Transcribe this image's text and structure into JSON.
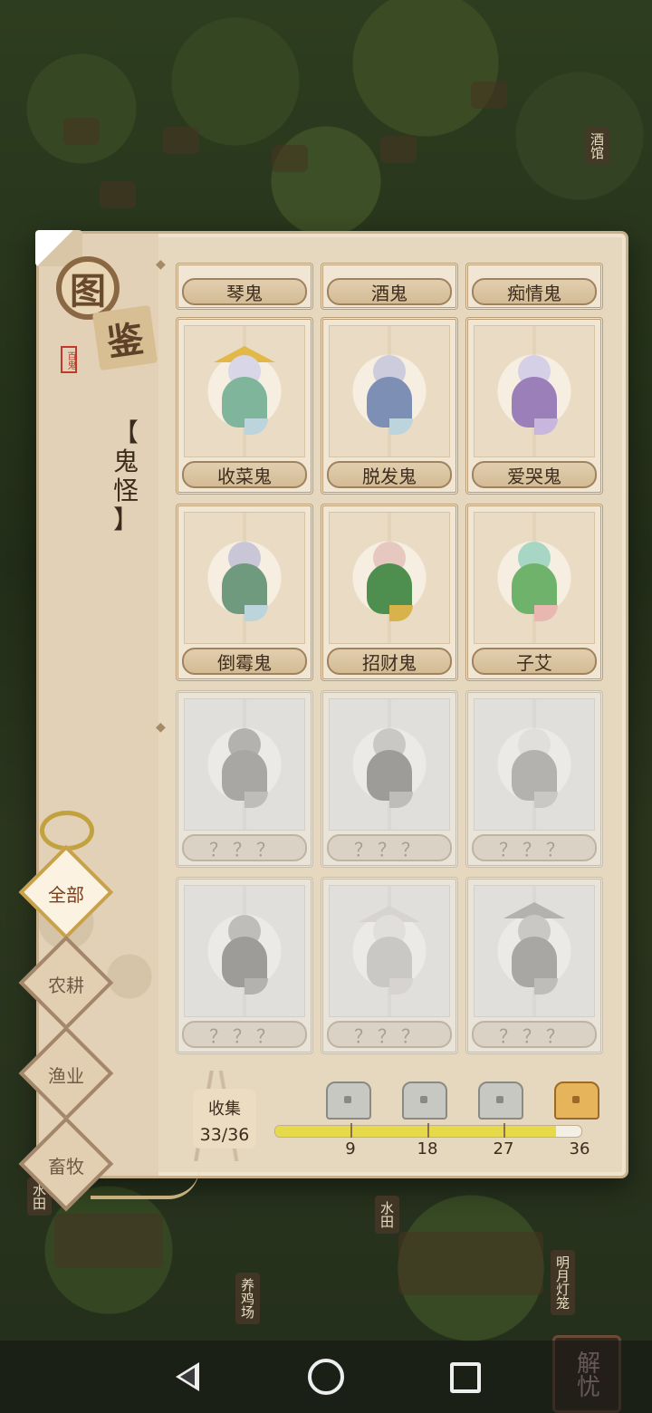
{
  "title": {
    "main_chars": [
      "图",
      "鉴"
    ],
    "stamp": "百鬼"
  },
  "category": {
    "text": [
      "【",
      "鬼",
      "怪",
      "】"
    ]
  },
  "grid": {
    "top_row": [
      "琴鬼",
      "酒鬼",
      "痴情鬼"
    ],
    "rows": [
      [
        {
          "name": "收菜鬼",
          "unlocked": true,
          "icon": "farmer-ghost-icon",
          "color": "#7fb59a"
        },
        {
          "name": "脱发鬼",
          "unlocked": true,
          "icon": "scholar-ghost-icon",
          "color": "#7e8fb5"
        },
        {
          "name": "爱哭鬼",
          "unlocked": true,
          "icon": "crying-ghost-icon",
          "color": "#9a7fb8"
        }
      ],
      [
        {
          "name": "倒霉鬼",
          "unlocked": true,
          "icon": "unlucky-ghost-icon",
          "color": "#6f9a7d"
        },
        {
          "name": "招财鬼",
          "unlocked": true,
          "icon": "fortune-ghost-icon",
          "color": "#4e8f4f"
        },
        {
          "name": "子艾",
          "unlocked": true,
          "icon": "flower-ghost-icon",
          "color": "#6fb26b"
        }
      ],
      [
        {
          "name": "？？？",
          "unlocked": false,
          "icon": "boat-ghost-icon"
        },
        {
          "name": "？？？",
          "unlocked": false,
          "icon": "rabbit-lady-ghost-icon"
        },
        {
          "name": "？？？",
          "unlocked": false,
          "icon": "rabbit-ghost-icon"
        }
      ],
      [
        {
          "name": "？？？",
          "unlocked": false,
          "icon": "dragon-rider-ghost-icon"
        },
        {
          "name": "？？？",
          "unlocked": false,
          "icon": "robed-ghost-icon"
        },
        {
          "name": "？？？",
          "unlocked": false,
          "icon": "palanquin-ghost-icon"
        }
      ]
    ]
  },
  "collection": {
    "label": "收集",
    "count": "33/36",
    "current": 33,
    "total": 36,
    "milestones": [
      "9",
      "18",
      "27",
      "36"
    ]
  },
  "tabs": [
    {
      "label": "全部",
      "active": true
    },
    {
      "label": "农耕",
      "active": false
    },
    {
      "label": "渔业",
      "active": false
    },
    {
      "label": "畜牧",
      "active": false
    }
  ],
  "background_signs": [
    "酒馆",
    "水田",
    "水田",
    "养鸡场",
    "明月灯笼"
  ],
  "corner_button": "解忧",
  "colors": {
    "progress": "#e6d94a",
    "panel": "#e6d7bf",
    "active_tab": "#fbf2e1"
  }
}
